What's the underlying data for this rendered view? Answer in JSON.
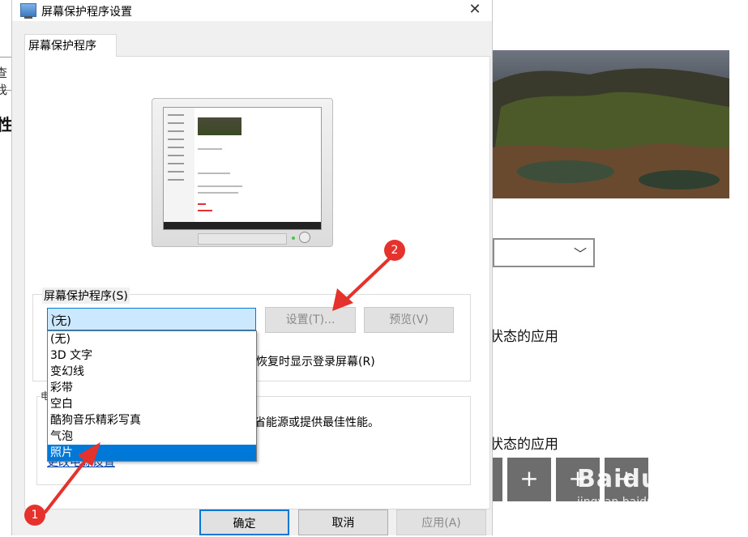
{
  "background": {
    "search_fragment": "查找",
    "heading_fragment": "性化",
    "app_label_1": "状态的应用",
    "app_label_2": "状态的应用",
    "tiles": [
      "+",
      "+",
      "+"
    ]
  },
  "dialog": {
    "title": "屏幕保护程序设置",
    "close_glyph": "✕",
    "tab": "屏幕保护程序",
    "screensaver_group_label": "屏幕保护程序(S)",
    "selected_value": "(无)",
    "settings_button": "设置(T)...",
    "preview_button": "预览(V)",
    "login_text": "恢复时显示登录屏幕(R)",
    "power_group_label": "电",
    "power_text": "省能源或提供最佳性能。",
    "power_link": "更改电源设置",
    "options": [
      "(无)",
      "3D 文字",
      "变幻线",
      "彩带",
      "空白",
      "酷狗音乐精彩写真",
      "气泡",
      "照片"
    ],
    "highlighted_option": "照片",
    "ok_button": "确定",
    "cancel_button": "取消",
    "apply_button": "应用(A)"
  },
  "annotations": {
    "badge_1": "1",
    "badge_2": "2"
  },
  "watermark": {
    "brand": "Baidu经验",
    "sub": "jingyan.baidu.com"
  },
  "colors": {
    "accent": "#0078d7",
    "annotation_red": "#e5322d",
    "dialog_bg": "#f0f0f0"
  }
}
